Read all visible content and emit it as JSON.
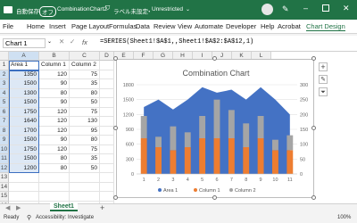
{
  "titlebar": {
    "autosave_label": "自動保存",
    "autosave_state": "オフ",
    "filename": "CombinationChart2",
    "sensitivity": "ラベル未設定",
    "separator": "・",
    "save_state": "Unrestricted"
  },
  "menu": [
    "File",
    "Home",
    "Insert",
    "Page Layout",
    "Formulas",
    "Data",
    "Review",
    "View",
    "Automate",
    "Developer",
    "Help",
    "Acrobat",
    "Chart Design"
  ],
  "formula_bar": {
    "name_box": "Chart 1",
    "fx": "fx",
    "formula": "=SERIES(Sheet1!$A$1,,Sheet1!$A$2:$A$12,1)"
  },
  "columns": [
    "A",
    "B",
    "C",
    "D",
    "E",
    "F",
    "G",
    "H",
    "I",
    "J",
    "K",
    "L"
  ],
  "rows": [
    "1",
    "2",
    "3",
    "4",
    "5",
    "6",
    "7",
    "8",
    "9",
    "10",
    "11",
    "12",
    "13",
    "14",
    "15",
    "16"
  ],
  "table": {
    "headers": [
      "Area 1",
      "Column 1",
      "Column 2"
    ],
    "data": [
      [
        "1350",
        "120",
        "75"
      ],
      [
        "1500",
        "90",
        "35"
      ],
      [
        "1300",
        "80",
        "80"
      ],
      [
        "1500",
        "90",
        "50"
      ],
      [
        "1750",
        "120",
        "75"
      ],
      [
        "1640",
        "120",
        "130"
      ],
      [
        "1700",
        "120",
        "95"
      ],
      [
        "1500",
        "90",
        "80"
      ],
      [
        "1750",
        "120",
        "75"
      ],
      [
        "1500",
        "80",
        "35"
      ],
      [
        "1200",
        "80",
        "50"
      ]
    ]
  },
  "chart_data": {
    "type": "area+bar",
    "title": "Combination Chart",
    "categories": [
      "1",
      "2",
      "3",
      "4",
      "5",
      "6",
      "7",
      "8",
      "9",
      "10",
      "11"
    ],
    "series": [
      {
        "name": "Area 1",
        "type": "area",
        "axis": "primary",
        "values": [
          1350,
          1500,
          1300,
          1500,
          1750,
          1640,
          1700,
          1500,
          1750,
          1500,
          1200
        ]
      },
      {
        "name": "Column 1",
        "type": "stacked-bar",
        "axis": "secondary",
        "values": [
          120,
          90,
          80,
          90,
          120,
          120,
          120,
          90,
          120,
          80,
          80
        ]
      },
      {
        "name": "Column 2",
        "type": "stacked-bar",
        "axis": "secondary",
        "values": [
          75,
          35,
          80,
          50,
          75,
          130,
          95,
          80,
          75,
          35,
          50
        ]
      }
    ],
    "y_left_ticks": [
      "0",
      "300",
      "600",
      "900",
      "1200",
      "1500",
      "1800"
    ],
    "y_right_ticks": [
      "0",
      "50",
      "100",
      "150",
      "200",
      "250",
      "300"
    ],
    "ylim_left": [
      0,
      1800
    ],
    "ylim_right": [
      0,
      300
    ],
    "legend_position": "bottom",
    "colors": {
      "Area 1": "#4472c4",
      "Column 1": "#ed7d31",
      "Column 2": "#a5a5a5"
    }
  },
  "sheet_tab": "Sheet1",
  "add_sheet": "+",
  "status": {
    "ready": "Ready",
    "accessibility": "Accessibility: Investigate",
    "zoom": "100%"
  }
}
